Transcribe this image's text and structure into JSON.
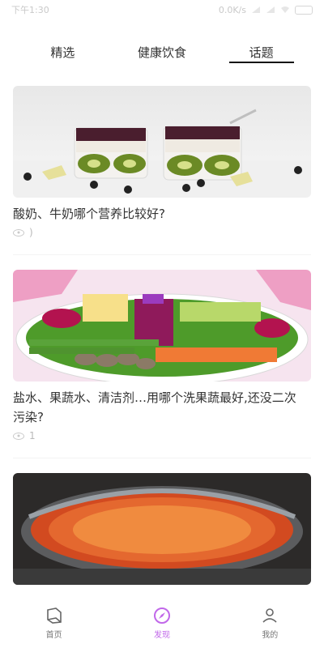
{
  "status_bar": {
    "time": "下午1:30",
    "signal_text": "0.0K/s"
  },
  "tabs": [
    {
      "label": "精选",
      "active": false
    },
    {
      "label": "健康饮食",
      "active": false
    },
    {
      "label": "话题",
      "active": true
    }
  ],
  "feed": [
    {
      "title": "酸奶、牛奶哪个营养比较好?",
      "views": ")",
      "image_icon": "dessert-cups-photo"
    },
    {
      "title": "盐水、果蔬水、清洁剂…用哪个洗果蔬最好,还没二次污染?",
      "views": "1",
      "image_icon": "vegetable-platter-photo"
    },
    {
      "title": "",
      "views": "",
      "image_icon": "hot-pan-food-photo"
    }
  ],
  "bottom_nav": [
    {
      "label": "首页",
      "icon": "book-icon",
      "active": false
    },
    {
      "label": "发现",
      "icon": "compass-icon",
      "active": true
    },
    {
      "label": "我的",
      "icon": "user-icon",
      "active": false
    }
  ],
  "colors": {
    "accent": "#c168e9",
    "text": "#333333",
    "muted": "#b9b9b9"
  }
}
